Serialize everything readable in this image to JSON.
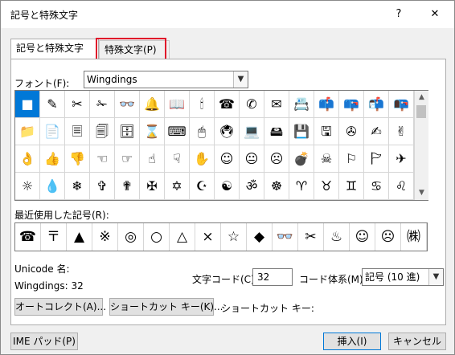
{
  "window": {
    "title": "記号と特殊文字",
    "help_label": "?",
    "close_label": "✕"
  },
  "tabs": [
    {
      "label": "記号と特殊文字(S)"
    },
    {
      "label": "特殊文字(P)"
    }
  ],
  "font": {
    "label": "フォント(F):",
    "value": "Wingdings"
  },
  "symbols": [
    "■",
    "✎",
    "✂",
    "✁",
    "👓",
    "🔔",
    "📖",
    "🕯",
    "☎",
    "✆",
    "✉",
    "📇",
    "📫",
    "📪",
    "📬",
    "📭",
    "📁",
    "📄",
    "🗏",
    "🗐",
    "🗄",
    "⌛",
    "⌨",
    "🖱",
    "🖲",
    "💻",
    "🖴",
    "💾",
    "🖫",
    "✇",
    "✍",
    "✌",
    "👌",
    "👍",
    "👎",
    "☜",
    "☞",
    "☝",
    "☟",
    "✋",
    "☺",
    "😐",
    "☹",
    "💣",
    "☠",
    "⚐",
    "🏱",
    "✈",
    "☼",
    "💧",
    "❄",
    "✞",
    "✟",
    "✠",
    "✡",
    "☪",
    "☯",
    "ॐ",
    "☸",
    "♈",
    "♉",
    "♊",
    "♋",
    "♌",
    "♍"
  ],
  "recent": {
    "label": "最近使用した記号(R):",
    "items": [
      "☎",
      "〒",
      "▲",
      "※",
      "◎",
      "○",
      "△",
      "×",
      "☆",
      "◆",
      "👓",
      "✂",
      "♨",
      "☺",
      "☹",
      "㈱",
      "㈲"
    ]
  },
  "unicode": {
    "name_label": "Unicode 名:",
    "name_value": "Wingdings: 32"
  },
  "char_code": {
    "label": "文字コード(C):",
    "value": "32"
  },
  "code_system": {
    "label": "コード体系(M):",
    "value": "記号 (10 進)"
  },
  "buttons": {
    "autocorrect": "オートコレクト(A)...",
    "shortcut_key": "ショートカット キー(K)...",
    "shortcut_label": "ショートカット キー:",
    "ime_pad": "IME パッド(P)",
    "insert": "挿入(I)",
    "cancel": "キャンセル"
  }
}
